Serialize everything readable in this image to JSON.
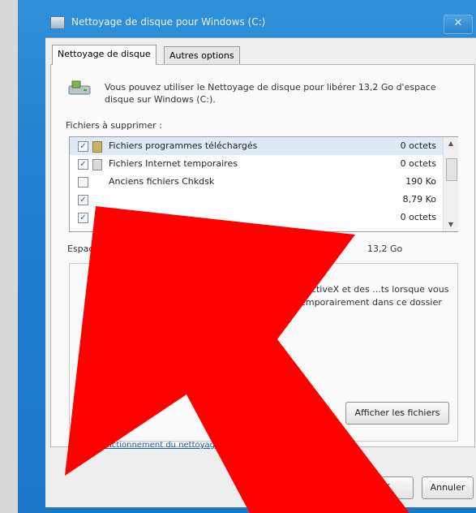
{
  "window": {
    "title": "Nettoyage de disque pour Windows (C:)",
    "close_glyph": "✕"
  },
  "tabs": [
    {
      "label": "Nettoyage de disque"
    },
    {
      "label": "Autres options"
    }
  ],
  "intro_text": "Vous pouvez utiliser le Nettoyage de disque pour libérer 13,2 Go d'espace disque sur Windows (C:).",
  "files_section_label": "Fichiers à supprimer :",
  "file_rows": [
    {
      "checked": true,
      "check_glyph": "✓",
      "name": "Fichiers programmes téléchargés",
      "size": "0 octets"
    },
    {
      "checked": true,
      "check_glyph": "✓",
      "name": "Fichiers Internet temporaires",
      "size": "0 octets"
    },
    {
      "checked": false,
      "check_glyph": "",
      "name": "Anciens fichiers Chkdsk",
      "size": "190 Ko"
    },
    {
      "checked": true,
      "check_glyph": "✓",
      "name": "",
      "size": "8,79 Ko"
    },
    {
      "checked": true,
      "check_glyph": "✓",
      "name": "",
      "size": "0 octets"
    }
  ],
  "space_label": "Espace disque total récupéré :",
  "space_value": "13,2 Go",
  "description_text": "...es contrôles ActiveX et des ...ts lorsque vous consultez ... temporairement dans ce dossier sur",
  "view_files_button": "Afficher les fichiers",
  "help_link": "Fonctionnement du nettoyage",
  "ok_button": "OK",
  "cancel_button": "Annuler",
  "overlay": {
    "arrow_color": "#ff0000"
  }
}
